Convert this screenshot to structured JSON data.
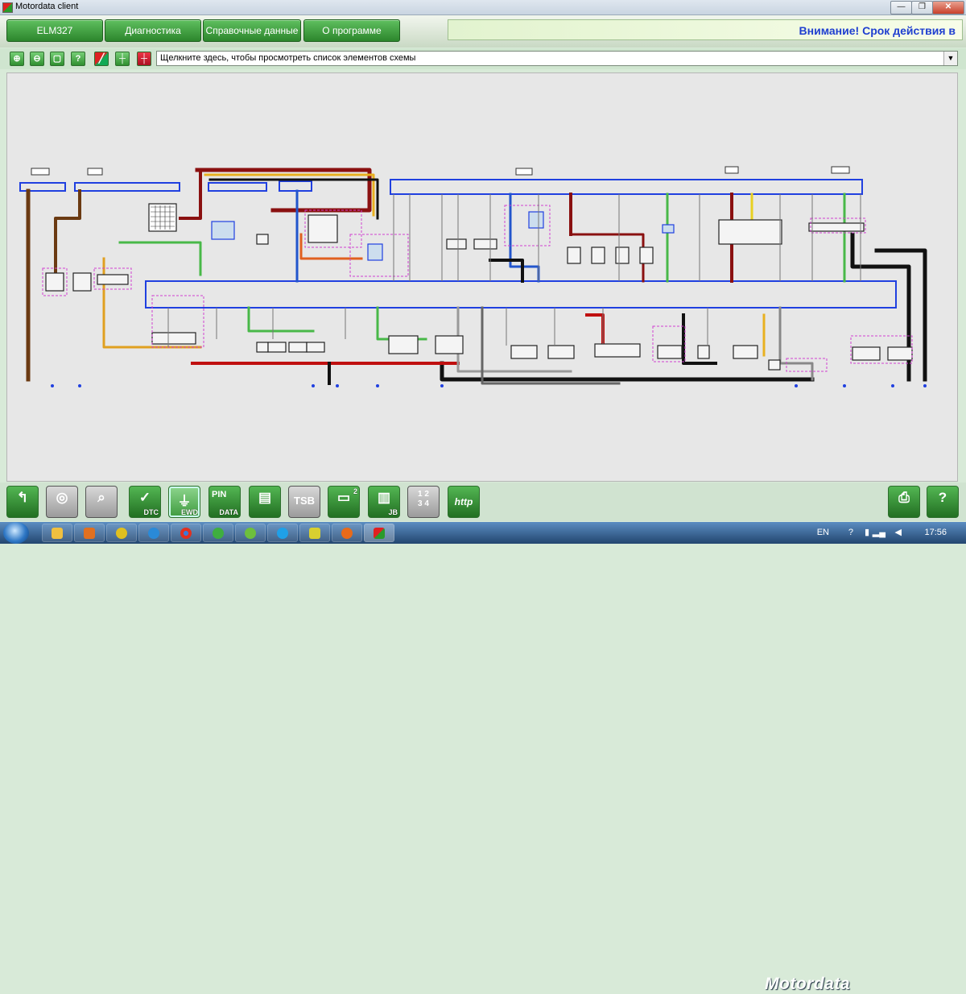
{
  "window": {
    "title": "Motordata client",
    "min_label": "—",
    "max_label": "❐",
    "close_label": "✕"
  },
  "nav": {
    "items": [
      "ELM327",
      "Диагностика",
      "Справочные данные",
      "О программе"
    ],
    "notice": "Внимание! Срок действия в"
  },
  "toolbar": {
    "icons": [
      "zoom-in-icon",
      "zoom-out-icon",
      "fit-icon",
      "help-icon",
      "color-lines-icon",
      "grid-icon",
      "marker-icon"
    ],
    "glyphs": [
      "⊕",
      "⊖",
      "▢",
      "?",
      "╱",
      "┼",
      "┼"
    ],
    "dropdown_text": "Щелкните здесь, чтобы просмотреть список элементов схемы"
  },
  "bottom": {
    "buttons": [
      {
        "name": "back",
        "label": "",
        "sym": "↰"
      },
      {
        "name": "obd",
        "label": "",
        "sym": "◎"
      },
      {
        "name": "search",
        "label": "",
        "sym": "⌕"
      },
      {
        "name": "dtc",
        "label": "DTC",
        "sym": "✓"
      },
      {
        "name": "ewd",
        "label": "EWD",
        "sym": "⏚"
      },
      {
        "name": "pin-data",
        "label": "DATA",
        "sym": "PIN"
      },
      {
        "name": "service",
        "label": "",
        "sym": "▤"
      },
      {
        "name": "tsb",
        "label": "",
        "sym": "TSB"
      },
      {
        "name": "vehicle",
        "label": "2",
        "sym": "🚗"
      },
      {
        "name": "jb",
        "label": "JB",
        "sym": "▥"
      },
      {
        "name": "numbers",
        "label": "",
        "sym": "1 2\n3 4"
      },
      {
        "name": "http",
        "label": "",
        "sym": "http"
      }
    ],
    "brand": "Motordata",
    "print_label": "",
    "help_label": "?"
  },
  "taskbar": {
    "lang": "EN",
    "time": "17:56"
  },
  "colors": {
    "accent": "#2c862c",
    "notice_text": "#1f3fd0"
  }
}
